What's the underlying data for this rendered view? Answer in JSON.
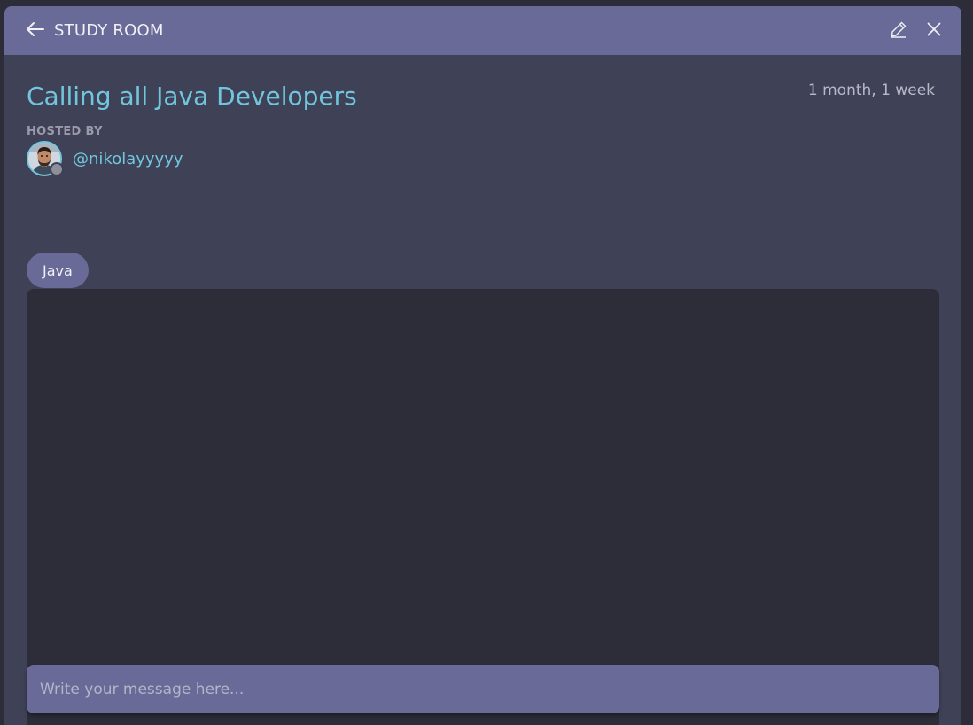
{
  "header": {
    "title": "STUDY ROOM",
    "back_icon": "arrow-left-icon",
    "edit_icon": "pencil-icon",
    "close_icon": "close-icon"
  },
  "room": {
    "title": "Calling all Java Developers",
    "age": "1 month, 1 week",
    "hosted_label": "HOSTED BY",
    "host_username": "@nikolayyyyy",
    "host_status": "offline",
    "topic": "Java"
  },
  "composer": {
    "placeholder": "Write your message here..."
  },
  "colors": {
    "header_bg": "#6a6a99",
    "panel_bg": "#3f4156",
    "accent": "#71c6dd",
    "chat_bg": "#2d2d39"
  }
}
